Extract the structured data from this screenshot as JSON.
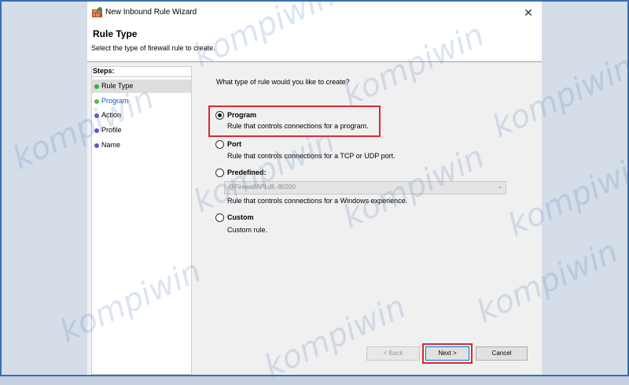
{
  "window": {
    "title": "New Inbound Rule Wizard",
    "close_glyph": "✕",
    "header": {
      "title": "Rule Type",
      "subtitle": "Select the type of firewall rule to create."
    }
  },
  "steps": {
    "title": "Steps:",
    "items": [
      {
        "label": "Rule Type",
        "state": "current",
        "dot_color": "#2fb52f",
        "text_color": "#000000"
      },
      {
        "label": "Program",
        "state": "next",
        "dot_color": "#4fc34f",
        "text_color": "#0a56c9"
      },
      {
        "label": "Action",
        "state": "pending",
        "dot_color": "#5b5bd6",
        "text_color": "#000000"
      },
      {
        "label": "Profile",
        "state": "pending",
        "dot_color": "#5b5bd6",
        "text_color": "#000000"
      },
      {
        "label": "Name",
        "state": "pending",
        "dot_color": "#5b5bd6",
        "text_color": "#000000"
      }
    ]
  },
  "main": {
    "question": "What type of rule would you like to create?",
    "options": [
      {
        "label": "Program",
        "desc": "Rule that controls connections for a program.",
        "selected": true
      },
      {
        "label": "Port",
        "desc": "Rule that controls connections for a TCP or UDP port.",
        "selected": false
      },
      {
        "label": "Predefined:",
        "desc": "Rule that controls connections for a Windows experience.",
        "selected": false
      },
      {
        "label": "Custom",
        "desc": "Custom rule.",
        "selected": false
      }
    ],
    "predefined_select": {
      "value": "@FirewallAPI.dll,-80200",
      "enabled": false
    }
  },
  "buttons": {
    "back": "< Back",
    "next": "Next >",
    "cancel": "Cancel"
  },
  "watermark": "kompiwin",
  "colors": {
    "highlight_box": "#e1262c",
    "frame_border": "#3a6fb0"
  }
}
